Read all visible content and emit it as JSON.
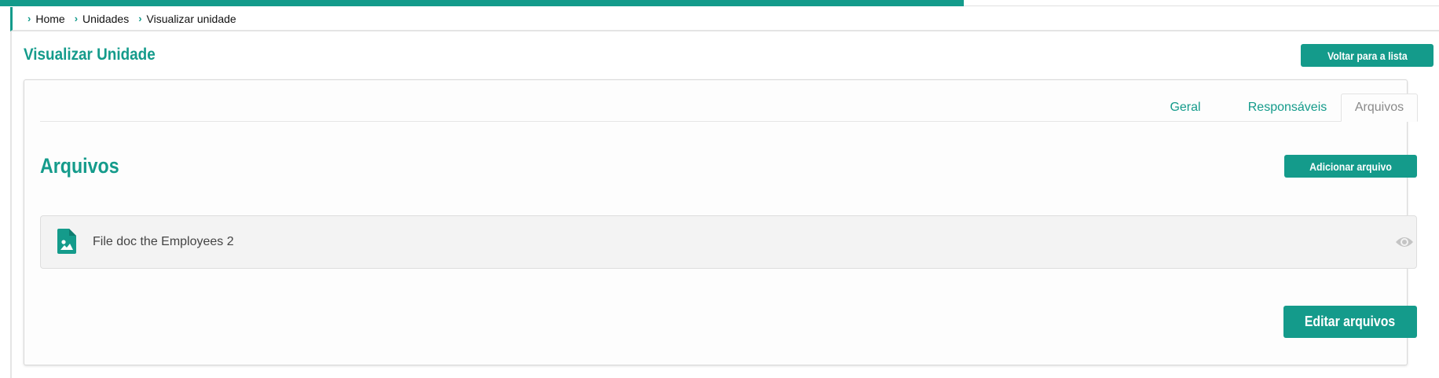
{
  "progress": {
    "percent": 67,
    "color": "#149b8b"
  },
  "breadcrumb": {
    "items": [
      {
        "label": "Home"
      },
      {
        "label": "Unidades"
      },
      {
        "label": "Visualizar unidade"
      }
    ]
  },
  "page": {
    "title": "Visualizar Unidade",
    "back_button_label": "Voltar para a lista"
  },
  "tabs": [
    {
      "label": "Geral",
      "active": false
    },
    {
      "label": "Responsáveis",
      "active": false
    },
    {
      "label": "Arquivos",
      "active": true
    }
  ],
  "files_section": {
    "title": "Arquivos",
    "add_button_label": "Adicionar arquivo",
    "files": [
      {
        "name": "File doc the Employees 2",
        "icon": "file-image-icon",
        "action_icon": "eye-icon"
      }
    ],
    "edit_button_label": "Editar arquivos"
  },
  "colors": {
    "accent": "#149b8b",
    "muted_text": "#8a8a8a",
    "row_bg": "#f3f3f3"
  }
}
